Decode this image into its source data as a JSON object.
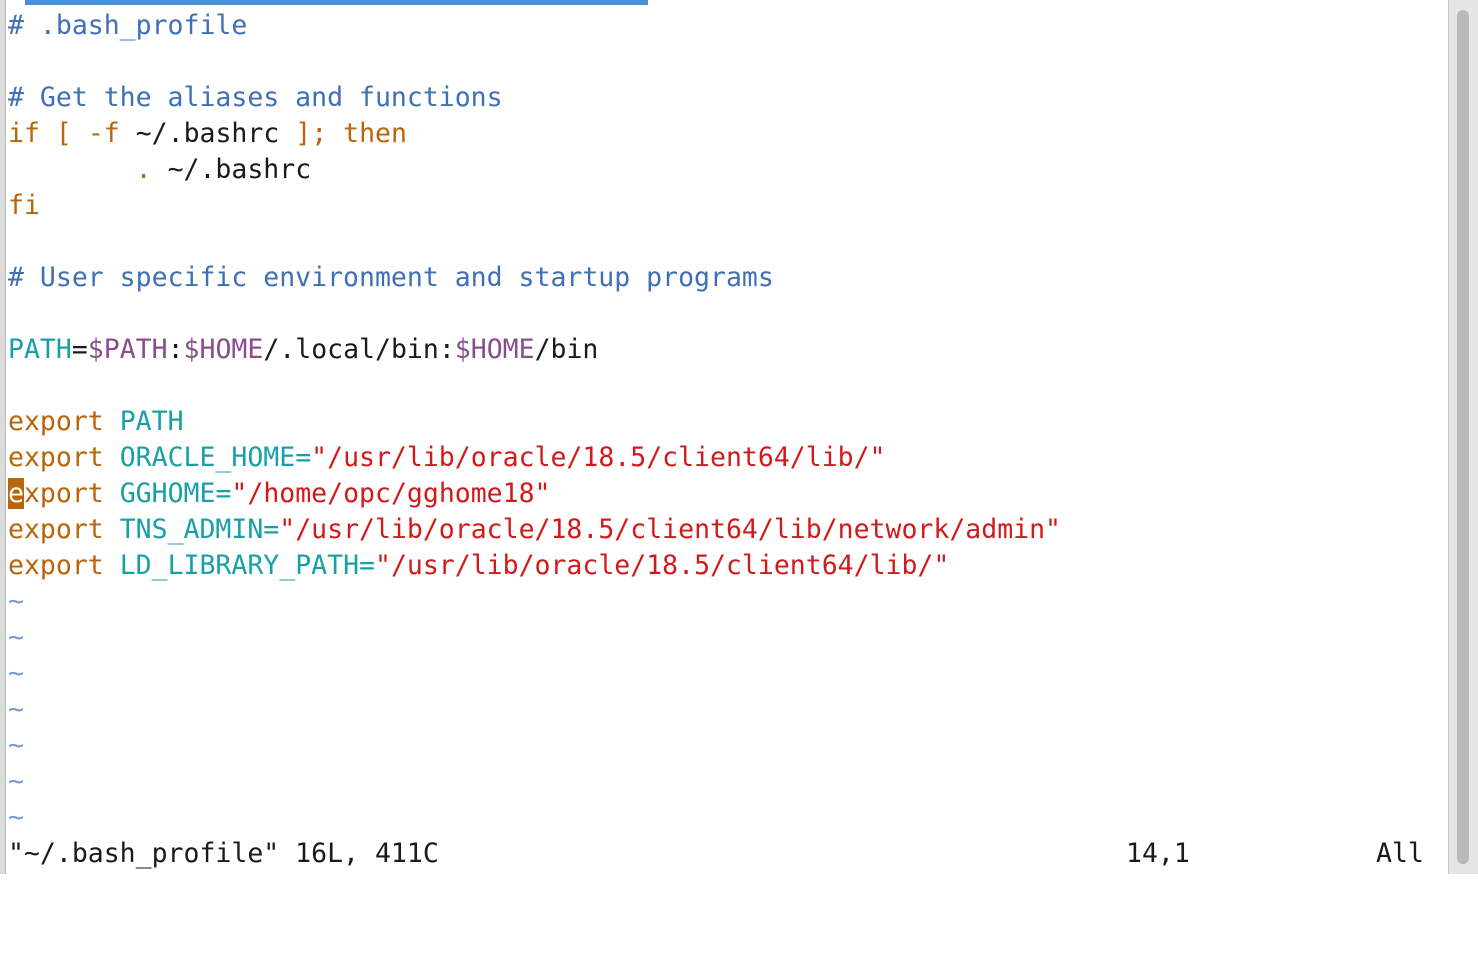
{
  "editor": {
    "lines": [
      [
        {
          "t": "# .bash_profile",
          "c": "comment"
        }
      ],
      [],
      [
        {
          "t": "# Get the aliases and functions",
          "c": "comment"
        }
      ],
      [
        {
          "t": "if",
          "c": "kw"
        },
        {
          "t": " "
        },
        {
          "t": "[",
          "c": "kw"
        },
        {
          "t": " "
        },
        {
          "t": "-f",
          "c": "kw"
        },
        {
          "t": " ~/.bashrc "
        },
        {
          "t": "];",
          "c": "kw"
        },
        {
          "t": " "
        },
        {
          "t": "then",
          "c": "kw"
        }
      ],
      [
        {
          "t": "        "
        },
        {
          "t": ".",
          "c": "kw"
        },
        {
          "t": " ~/.bashrc"
        }
      ],
      [
        {
          "t": "fi",
          "c": "kw"
        }
      ],
      [],
      [
        {
          "t": "# User specific environment and startup programs",
          "c": "comment"
        }
      ],
      [],
      [
        {
          "t": "PATH",
          "c": "var"
        },
        {
          "t": "="
        },
        {
          "t": "$PATH",
          "c": "dollar"
        },
        {
          "t": ":"
        },
        {
          "t": "$HOME",
          "c": "dollar"
        },
        {
          "t": "/.local/bin:"
        },
        {
          "t": "$HOME",
          "c": "dollar"
        },
        {
          "t": "/bin"
        }
      ],
      [],
      [
        {
          "t": "export",
          "c": "kw"
        },
        {
          "t": " "
        },
        {
          "t": "PATH",
          "c": "var"
        }
      ],
      [
        {
          "t": "export",
          "c": "kw"
        },
        {
          "t": " "
        },
        {
          "t": "ORACLE_HOME=",
          "c": "var"
        },
        {
          "t": "\"/usr/lib/oracle/18.5/client64/lib/\"",
          "c": "str"
        }
      ],
      [
        {
          "t": "e",
          "c": "kw cursor"
        },
        {
          "t": "xport",
          "c": "kw"
        },
        {
          "t": " "
        },
        {
          "t": "GGHOME=",
          "c": "var"
        },
        {
          "t": "\"/home/opc/gghome18\"",
          "c": "str"
        }
      ],
      [
        {
          "t": "export",
          "c": "kw"
        },
        {
          "t": " "
        },
        {
          "t": "TNS_ADMIN=",
          "c": "var"
        },
        {
          "t": "\"/usr/lib/oracle/18.5/client64/lib/network/admin\"",
          "c": "str"
        }
      ],
      [
        {
          "t": "export",
          "c": "kw"
        },
        {
          "t": " "
        },
        {
          "t": "LD_LIBRARY_PATH=",
          "c": "var"
        },
        {
          "t": "\"/usr/lib/oracle/18.5/client64/lib/\"",
          "c": "str"
        }
      ],
      [
        {
          "t": "~",
          "c": "tilde"
        }
      ],
      [
        {
          "t": "~",
          "c": "tilde"
        }
      ],
      [
        {
          "t": "~",
          "c": "tilde"
        }
      ],
      [
        {
          "t": "~",
          "c": "tilde"
        }
      ],
      [
        {
          "t": "~",
          "c": "tilde"
        }
      ],
      [
        {
          "t": "~",
          "c": "tilde"
        }
      ],
      [
        {
          "t": "~",
          "c": "tilde"
        }
      ]
    ]
  },
  "status": {
    "file_info": "\"~/.bash_profile\" 16L, 411C",
    "cursor_position": "14,1",
    "scroll_position": "All"
  },
  "colors": {
    "comment": "#3f6fb5",
    "keyword": "#b8660b",
    "variable": "#18a0a8",
    "dollar_variable": "#8b4c8c",
    "string": "#d21a1a",
    "tilde": "#7a9ad2",
    "cursor": "#b8660b",
    "progress_bar": "#4a90d9"
  }
}
